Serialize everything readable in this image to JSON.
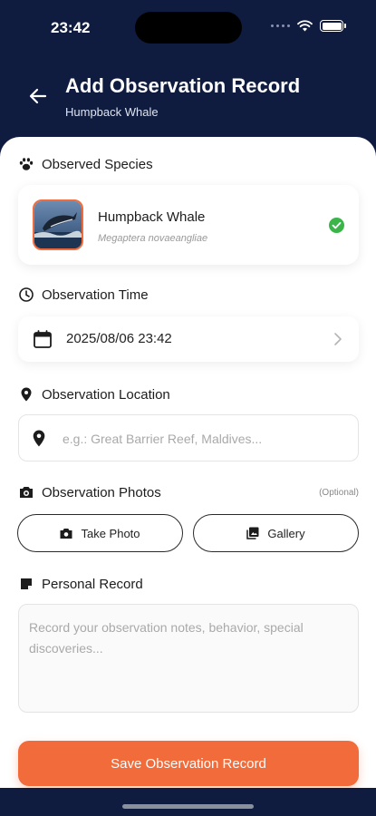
{
  "status_bar": {
    "time": "23:42"
  },
  "header": {
    "title": "Add Observation Record",
    "subtitle": "Humpback Whale"
  },
  "species_section": {
    "label": "Observed Species",
    "name": "Humpback Whale",
    "scientific_name": "Megaptera novaeangliae",
    "selected": true
  },
  "time_section": {
    "label": "Observation Time",
    "value": "2025/08/06 23:42"
  },
  "location_section": {
    "label": "Observation Location",
    "placeholder": "e.g.: Great Barrier Reef, Maldives...",
    "value": ""
  },
  "photos_section": {
    "label": "Observation Photos",
    "optional": "(Optional)",
    "take_photo": "Take Photo",
    "gallery": "Gallery"
  },
  "record_section": {
    "label": "Personal Record",
    "placeholder": "Record your observation notes, behavior, special discoveries...",
    "value": ""
  },
  "save_button": "Save Observation Record",
  "colors": {
    "navy": "#0f1c3f",
    "accent": "#f26b3a",
    "success": "#3bb44a"
  }
}
